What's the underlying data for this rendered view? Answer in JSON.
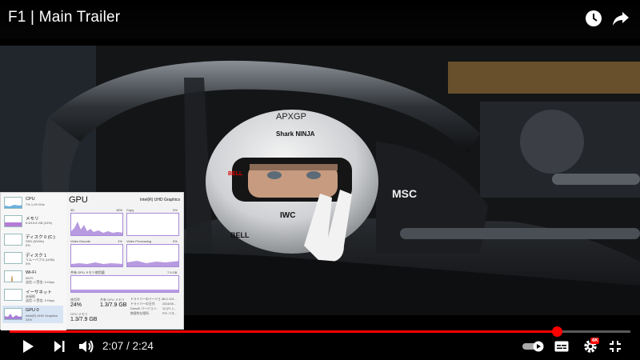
{
  "video": {
    "title": "F1 | Main Trailer",
    "current_time": "2:07",
    "separator": " / ",
    "duration": "2:24",
    "progress": 0.882,
    "quality_badge": "4K"
  },
  "top_actions": [
    {
      "icon": "watch-later-icon"
    },
    {
      "icon": "share-icon"
    }
  ],
  "controls": {
    "play_icon": "play-icon",
    "next_icon": "next-icon",
    "volume_icon": "volume-icon",
    "autoplay_icon": "autoplay-toggle-icon",
    "captions_icon": "captions-icon",
    "settings_icon": "settings-gear-icon",
    "fullscreen_icon": "fullscreen-icon"
  },
  "frame_text": {
    "helmet_top": "APXGP",
    "helmet_sponsor": "Shark NINJA",
    "helmet_bell": "BELL",
    "helmet_iwc": "IWC",
    "car_sponsor": "MSC"
  },
  "task_manager": {
    "sidebar": [
      {
        "name": "CPU",
        "sub": "7%  1.09 GHz",
        "sub2": ""
      },
      {
        "name": "メモリ",
        "sub": "6.5/15.8 GB (41%)",
        "sub2": ""
      },
      {
        "name": "ディスク 0 (C:)",
        "sub": "SSD (NVMe)",
        "sub2": "0%"
      },
      {
        "name": "ディスク 1",
        "sub": "リムーバブル (USB)",
        "sub2": "0%"
      },
      {
        "name": "Wi-Fi",
        "sub": "Wi-Fi",
        "sub2": "送信: 0 受信: 0 Kbps"
      },
      {
        "name": "イーサネット",
        "sub": "未接続",
        "sub2": "送信: 0 受信: 0 Kbps"
      },
      {
        "name": "GPU 0",
        "sub": "Intel(R) UHD Graphics",
        "sub2": "24%"
      }
    ],
    "gpu_title": "GPU",
    "gpu_model": "Intel(R) UHD Graphics",
    "graphs": [
      {
        "label": "3D",
        "pct": "15%"
      },
      {
        "label": "Copy",
        "pct": "0%"
      },
      {
        "label": "Video Decode",
        "pct": "1%"
      },
      {
        "label": "Video Processing",
        "pct": "0%"
      }
    ],
    "shared_label": "共有 GPU メモリ使用量",
    "shared_value": "7.9 GB",
    "stats": {
      "util_label": "使用率",
      "util_value": "24%",
      "shared_mem_label": "共有 GPU メモリ",
      "shared_mem_value": "1.3/7.9 GB",
      "gpu_mem_label": "GPU メモリ",
      "gpu_mem_value": "1.3/7.9 GB"
    },
    "info": [
      {
        "k": "ドライバーのバージョン:",
        "v": "31.0.101..."
      },
      {
        "k": "ドライバーの日付:",
        "v": "2024/08..."
      },
      {
        "k": "DirectX バージョン:",
        "v": "12 (FL 1..."
      },
      {
        "k": "物理的な場所:",
        "v": "PCI バス..."
      }
    ]
  }
}
